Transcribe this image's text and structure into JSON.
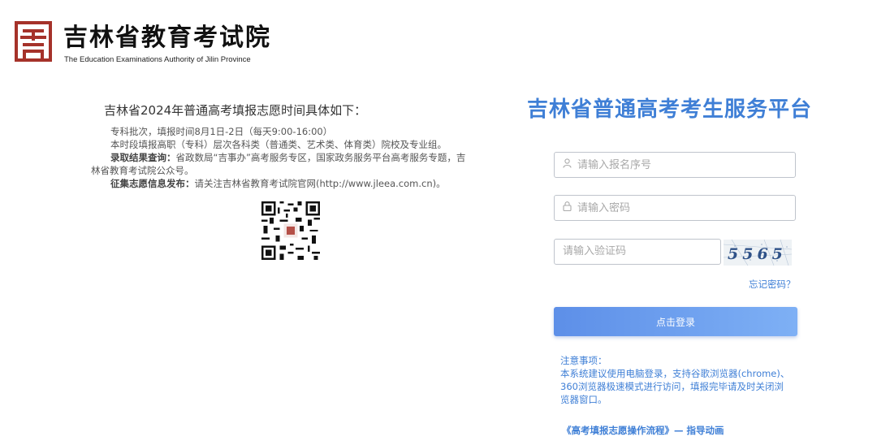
{
  "header": {
    "title": "吉林省教育考试院",
    "subtitle": "The Education Examinations Authority of Jilin Province",
    "brand_color": "#a5322a"
  },
  "notice": {
    "title": "吉林省2024年普通高考填报志愿时间具体如下：",
    "line1": "专科批次，填报时间8月1日-2日（每天9:00-16:00）",
    "line2": "本时段填报高职（专科）层次各科类（普通类、艺术类、体育类）院校及专业组。",
    "line3_bold": "录取结果查询：",
    "line3": "省政数局“吉事办”高考服务专区，国家政务服务平台高考服务专题，吉林省教育考试院公众号。",
    "line4_bold": "征集志愿信息发布：",
    "line4": "请关注吉林省教育考试院官网(http://www.jleea.com.cn)。",
    "qr_icon": "qr-code-icon"
  },
  "login": {
    "platform_title": "吉林省普通高考考生服务平台",
    "accent_color": "#3f7fd6",
    "username_placeholder": "请输入报名序号",
    "username_icon": "user-icon",
    "password_placeholder": "请输入密码",
    "password_icon": "lock-icon",
    "captcha_placeholder": "请输入验证码",
    "captcha_text": "5565",
    "forgot_label": "忘记密码？",
    "login_label": "点击登录",
    "tips_title": "注意事项：",
    "tips_text": "本系统建议使用电脑登录，支持谷歌浏览器(chrome)、360浏览器极速模式进行访问，填报完毕请及时关闭浏览器窗口。",
    "guide_label": "《高考填报志愿操作流程》— 指导动画"
  }
}
